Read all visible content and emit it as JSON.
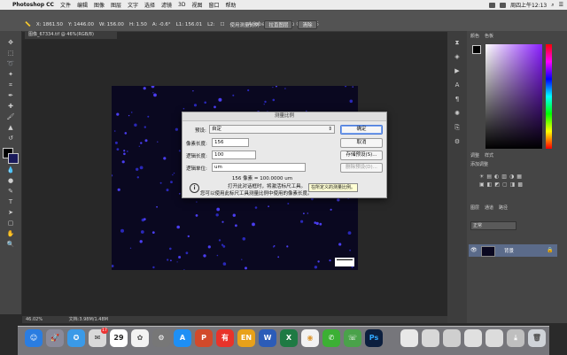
{
  "menubar": {
    "app_name": "Photoshop CC",
    "items": [
      "文件",
      "编辑",
      "图像",
      "图层",
      "文字",
      "选择",
      "滤镜",
      "3D",
      "视图",
      "窗口",
      "帮助"
    ],
    "clock": "周四上午12:13"
  },
  "options_bar": {
    "readouts": [
      "X: 1861.50",
      "Y: 1446.00",
      "W: 156.00",
      "H: 1.50",
      "A: -0.6°",
      "L1: 156.01",
      "L2:"
    ],
    "checkbox_label": "使用测量比例",
    "button1": "拉直图层",
    "button2": "清除"
  },
  "window_title": "Adobe Photoshop CC 2015",
  "document_tab": "图像_67334.tif @ 46%(RGB/8)",
  "status_bar": {
    "zoom": "46.02%",
    "doc_size": "文档:3.98M/1.48M"
  },
  "panels": {
    "color_tab": "颜色",
    "swatches_tab": "色板",
    "adjust_tab": "调整",
    "styles_tab": "样式",
    "add_adjustment": "添加调整",
    "layers_tab": "图层",
    "channels_tab": "通道",
    "paths_tab": "路径",
    "blend_mode": "正常",
    "layer_name": "背景"
  },
  "dialog": {
    "title": "测量比例",
    "preset_label": "预设:",
    "preset_value": "自定",
    "pixel_length_label": "像素长度:",
    "pixel_length_value": "156",
    "logical_length_label": "逻辑长度:",
    "logical_length_value": "100",
    "logical_units_label": "逻辑单位:",
    "logical_units_value": "um",
    "summary": "156 像素 = 100.0000 um",
    "info_line1": "打开此对话框时，将激活标尺工具。",
    "info_line2": "您可以使用此标尺工具测量比例中使用的像素长度。",
    "ok_label": "确定",
    "cancel_label": "取消",
    "save_preset_label": "存储预设(S)...",
    "delete_preset_label": "删除预设(D)..."
  },
  "tooltip": "在所定义的测量比例。",
  "dock": {
    "badge_count": "17",
    "calendar_day": "29"
  }
}
